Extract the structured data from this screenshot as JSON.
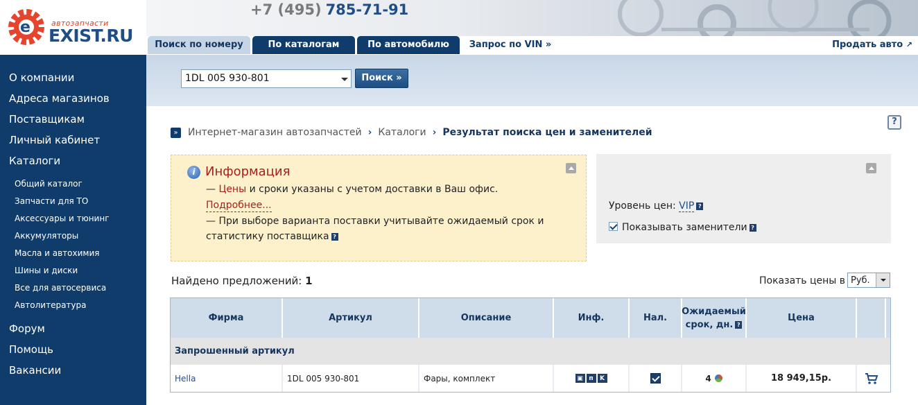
{
  "logo": {
    "subtitle": "автозапчасти",
    "name": "EXIST.RU"
  },
  "header": {
    "phone_prefix": "+7 (495)",
    "phone_number": "785-71-91"
  },
  "tabs": [
    {
      "label": "Поиск по номеру",
      "active": true
    },
    {
      "label": "По каталогам",
      "active": false
    },
    {
      "label": "По автомобилю",
      "active": false
    },
    {
      "label": "Запрос по VIN »",
      "active": false
    }
  ],
  "sell_link": "Продать авто",
  "search": {
    "value": "1DL 005 930-801",
    "button": "Поиск »"
  },
  "sidebar": {
    "items_top": [
      "О компании",
      "Адреса магазинов",
      "Поставщикам",
      "Личный кабинет",
      "Каталоги"
    ],
    "catalog_items": [
      "Общий каталог",
      "Запчасти для ТО",
      "Аксессуары и тюнинг",
      "Аккумуляторы",
      "Масла и автохимия",
      "Шины и диски",
      "Все для автосервиса",
      "Автолитература"
    ],
    "items_bottom": [
      "Форум",
      "Помощь",
      "Вакансии"
    ]
  },
  "breadcrumb": {
    "item1": "Интернет-магазин автозапчастей",
    "item2": "Каталоги",
    "current": "Результат поиска цен и заменителей"
  },
  "info": {
    "title": "Информация",
    "line1_prefix": "— ",
    "line1_red": "Цены",
    "line1_rest": " и сроки указаны с учетом доставки в Ваш офис.",
    "more_link": "Подробнее...",
    "line2": "— При выборе варианта поставки учитывайте ожидаемый срок и",
    "line3": "статистику поставщика"
  },
  "settings": {
    "price_level_label": "Уровень цен:",
    "price_level_value": "VIP",
    "show_substitutes": "Показывать заменители"
  },
  "results": {
    "found_label": "Найдено предложений:",
    "found_count": "1",
    "currency_label": "Показать цены в",
    "currency_value": "Руб.",
    "columns": {
      "firm": "Фирма",
      "article": "Артикул",
      "description": "Описание",
      "info": "Инф.",
      "availability": "Нал.",
      "term_line1": "Ожидаемый",
      "term_line2": "срок, дн.",
      "price": "Цена"
    },
    "group_title": "Запрошенный артикул",
    "rows": [
      {
        "firm": "Hella",
        "article": "1DL 005 930-801",
        "description": "Фары, комплект",
        "info_icons": [
          "camera-icon",
          "pn-icon",
          "k-icon"
        ],
        "term": "4",
        "price": "18 949,15р."
      }
    ]
  },
  "colors": {
    "brand_blue": "#0f3c6a",
    "accent_red": "#a8201a",
    "info_bg": "#fdf1cc"
  }
}
